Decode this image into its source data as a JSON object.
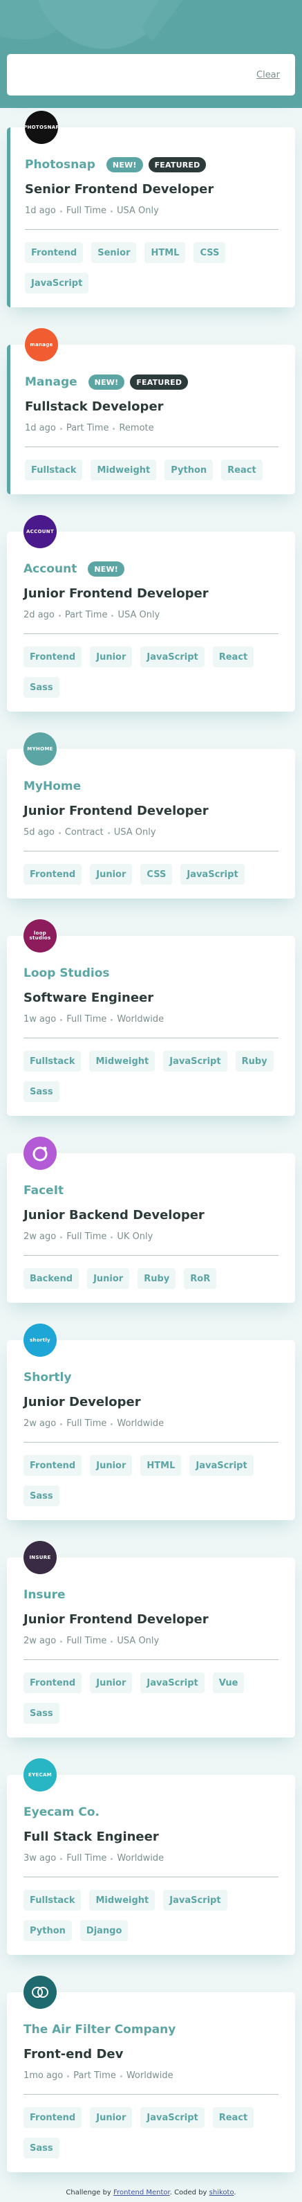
{
  "filter": {
    "clear_label": "Clear"
  },
  "jobs": [
    {
      "company": "Photosnap",
      "logo_text": "PHOTOSNAP",
      "logo_color": "#111111",
      "new_label": "NEW!",
      "featured_label": "FEATURED",
      "position": "Senior Frontend Developer",
      "posted": "1d ago",
      "contract": "Full Time",
      "location": "USA Only",
      "tags": [
        "Frontend",
        "Senior",
        "HTML",
        "CSS",
        "JavaScript"
      ]
    },
    {
      "company": "Manage",
      "logo_text": "manage",
      "logo_color": "#f15d31",
      "new_label": "NEW!",
      "featured_label": "FEATURED",
      "position": "Fullstack Developer",
      "posted": "1d ago",
      "contract": "Part Time",
      "location": "Remote",
      "tags": [
        "Fullstack",
        "Midweight",
        "Python",
        "React"
      ]
    },
    {
      "company": "Account",
      "logo_text": "ACCOUNT",
      "logo_color": "#4a1a8c",
      "new_label": "NEW!",
      "featured_label": "",
      "position": "Junior Frontend Developer",
      "posted": "2d ago",
      "contract": "Part Time",
      "location": "USA Only",
      "tags": [
        "Frontend",
        "Junior",
        "JavaScript",
        "React",
        "Sass"
      ]
    },
    {
      "company": "MyHome",
      "logo_text": "MYHOME",
      "logo_color": "#5ca5a5",
      "new_label": "",
      "featured_label": "",
      "position": "Junior Frontend Developer",
      "posted": "5d ago",
      "contract": "Contract",
      "location": "USA Only",
      "tags": [
        "Frontend",
        "Junior",
        "CSS",
        "JavaScript"
      ]
    },
    {
      "company": "Loop Studios",
      "logo_text": "loop studios",
      "logo_color": "#8c1c5c",
      "new_label": "",
      "featured_label": "",
      "position": "Software Engineer",
      "posted": "1w ago",
      "contract": "Full Time",
      "location": "Worldwide",
      "tags": [
        "Fullstack",
        "Midweight",
        "JavaScript",
        "Ruby",
        "Sass"
      ]
    },
    {
      "company": "FaceIt",
      "logo_text": "",
      "logo_color": "#b35ad6",
      "new_label": "",
      "featured_label": "",
      "position": "Junior Backend Developer",
      "posted": "2w ago",
      "contract": "Full Time",
      "location": "UK Only",
      "tags": [
        "Backend",
        "Junior",
        "Ruby",
        "RoR"
      ]
    },
    {
      "company": "Shortly",
      "logo_text": "shortly",
      "logo_color": "#1da6d6",
      "new_label": "",
      "featured_label": "",
      "position": "Junior Developer",
      "posted": "2w ago",
      "contract": "Full Time",
      "location": "Worldwide",
      "tags": [
        "Frontend",
        "Junior",
        "HTML",
        "JavaScript",
        "Sass"
      ]
    },
    {
      "company": "Insure",
      "logo_text": "INSURE",
      "logo_color": "#3a2b45",
      "new_label": "",
      "featured_label": "",
      "position": "Junior Frontend Developer",
      "posted": "2w ago",
      "contract": "Full Time",
      "location": "USA Only",
      "tags": [
        "Frontend",
        "Junior",
        "JavaScript",
        "Vue",
        "Sass"
      ]
    },
    {
      "company": "Eyecam Co.",
      "logo_text": "EYECAM",
      "logo_color": "#28b5c4",
      "new_label": "",
      "featured_label": "",
      "position": "Full Stack Engineer",
      "posted": "3w ago",
      "contract": "Full Time",
      "location": "Worldwide",
      "tags": [
        "Fullstack",
        "Midweight",
        "JavaScript",
        "Python",
        "Django"
      ]
    },
    {
      "company": "The Air Filter Company",
      "logo_text": "",
      "logo_color": "#1e6a6e",
      "new_label": "",
      "featured_label": "",
      "position": "Front-end Dev",
      "posted": "1mo ago",
      "contract": "Part Time",
      "location": "Worldwide",
      "tags": [
        "Frontend",
        "Junior",
        "JavaScript",
        "React",
        "Sass"
      ]
    }
  ],
  "footer": {
    "prefix": "Challenge by",
    "challenge_link": "Frontend Mentor",
    "middle": ". Coded by",
    "author_link": "shikoto",
    "suffix": "."
  },
  "colors": {
    "primary": "#5ca5a5",
    "dark": "#2c3a3a",
    "background": "#eff6f6",
    "tag_background": "#eef6f6"
  }
}
